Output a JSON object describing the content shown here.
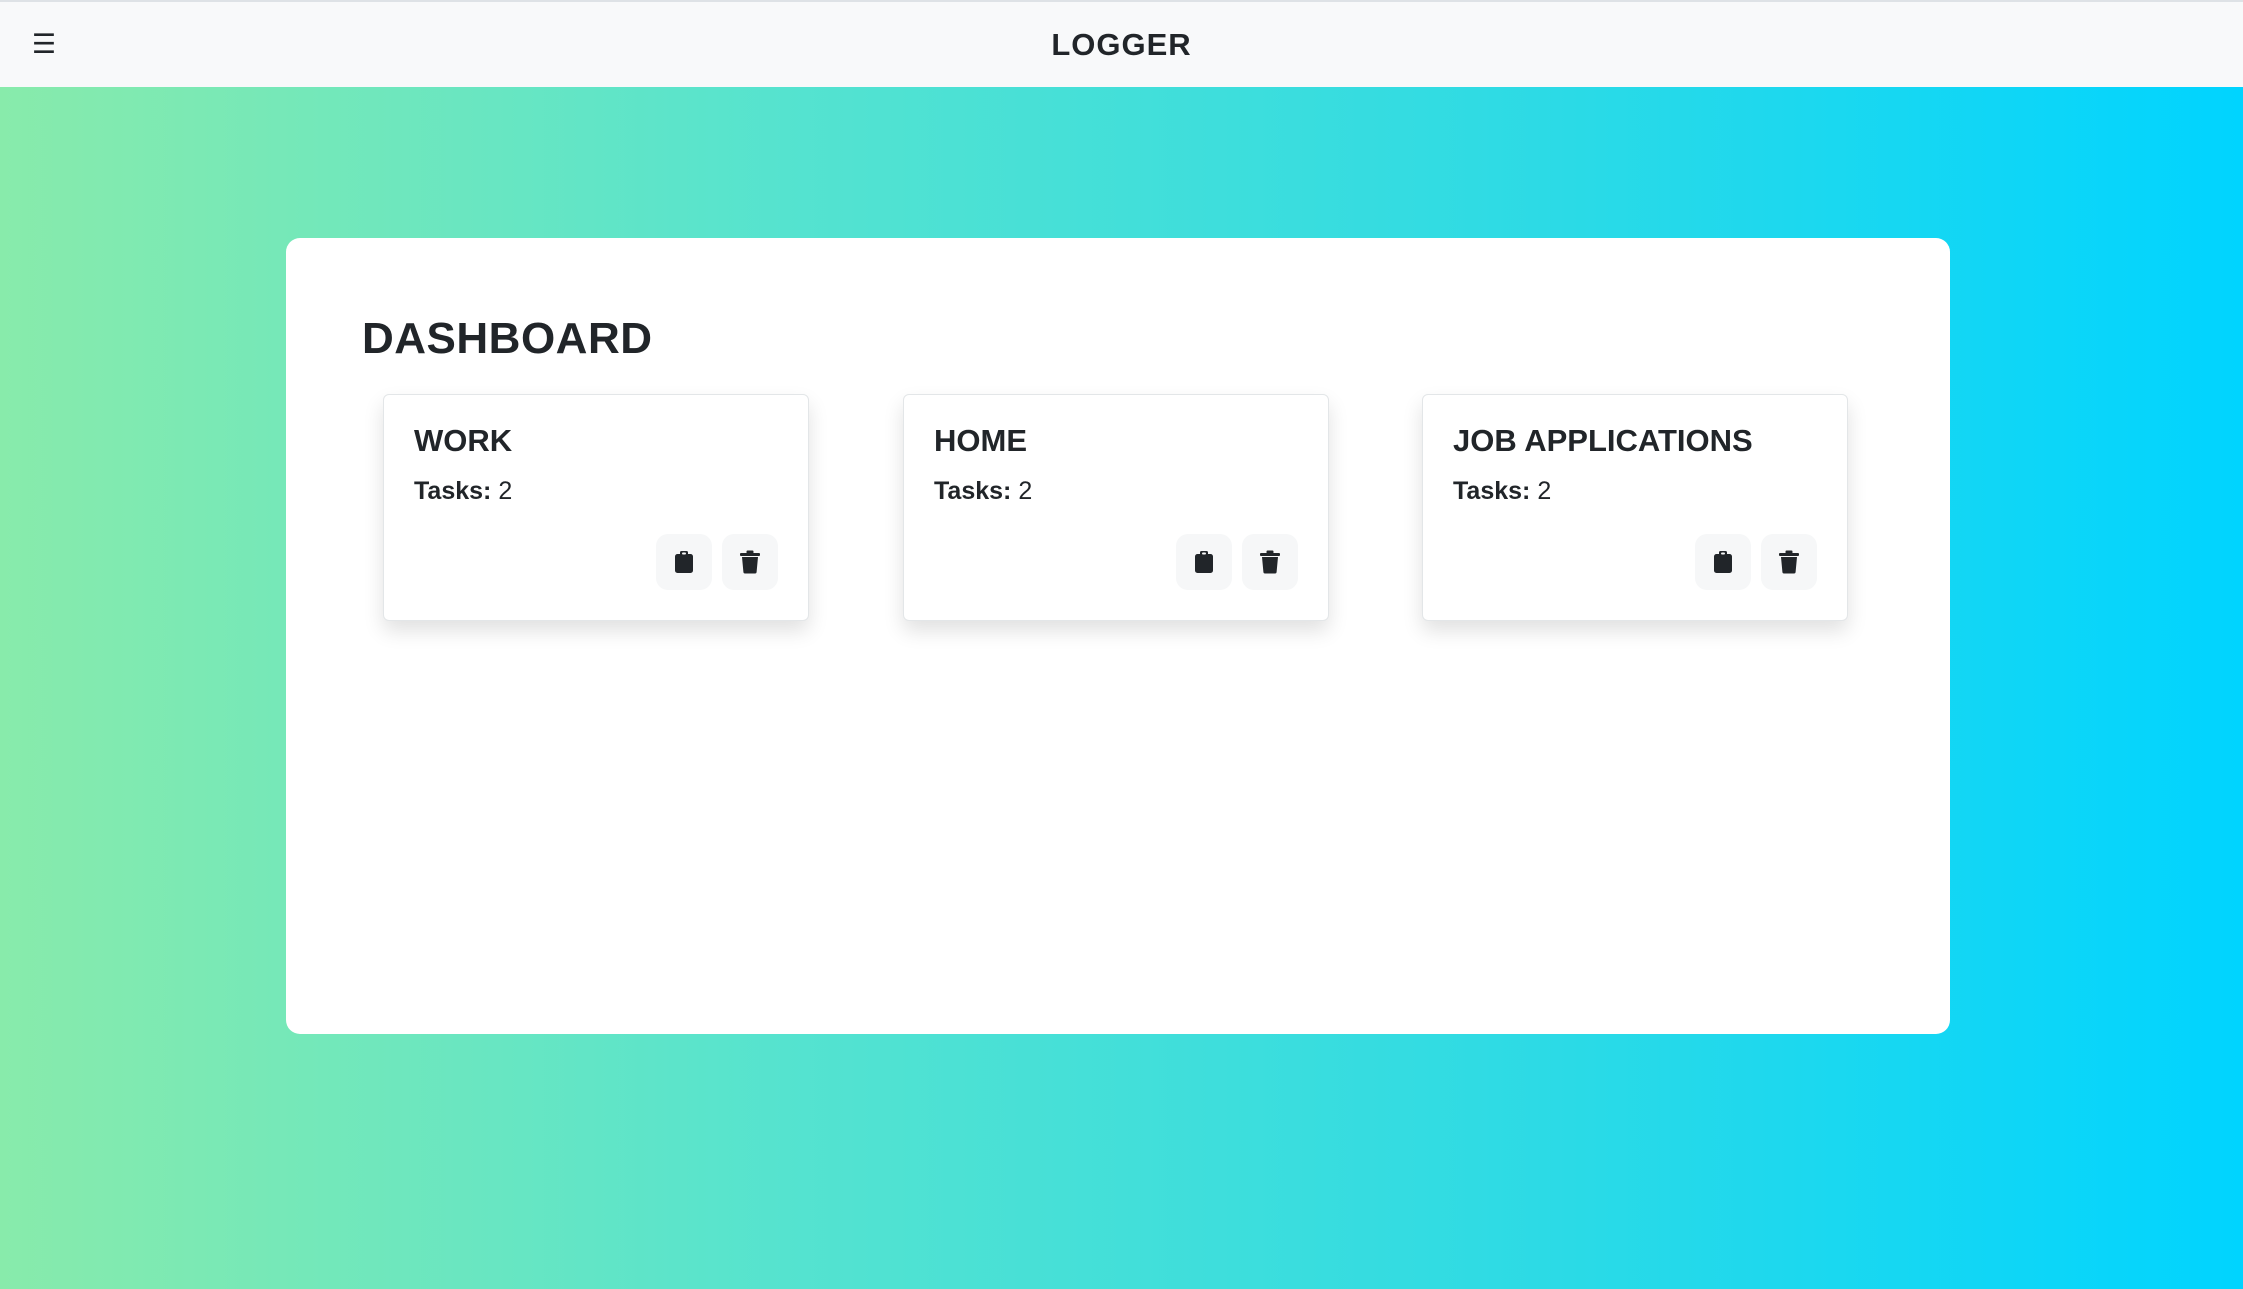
{
  "navbar": {
    "menu_icon": "☰",
    "brand": "LOGGER"
  },
  "dashboard": {
    "title": "DASHBOARD",
    "cards": [
      {
        "title": "WORK",
        "tasks_label": "Tasks:",
        "tasks_count": "2"
      },
      {
        "title": "HOME",
        "tasks_label": "Tasks:",
        "tasks_count": "2"
      },
      {
        "title": "JOB APPLICATIONS",
        "tasks_label": "Tasks:",
        "tasks_count": "2"
      }
    ]
  },
  "icons": {
    "open": "clipboard-icon",
    "delete": "trash-icon"
  },
  "colors": {
    "gradient_start": "#88ebab",
    "gradient_end": "#00d4ff",
    "navbar_bg": "#f8f9fa",
    "text": "#212529"
  }
}
